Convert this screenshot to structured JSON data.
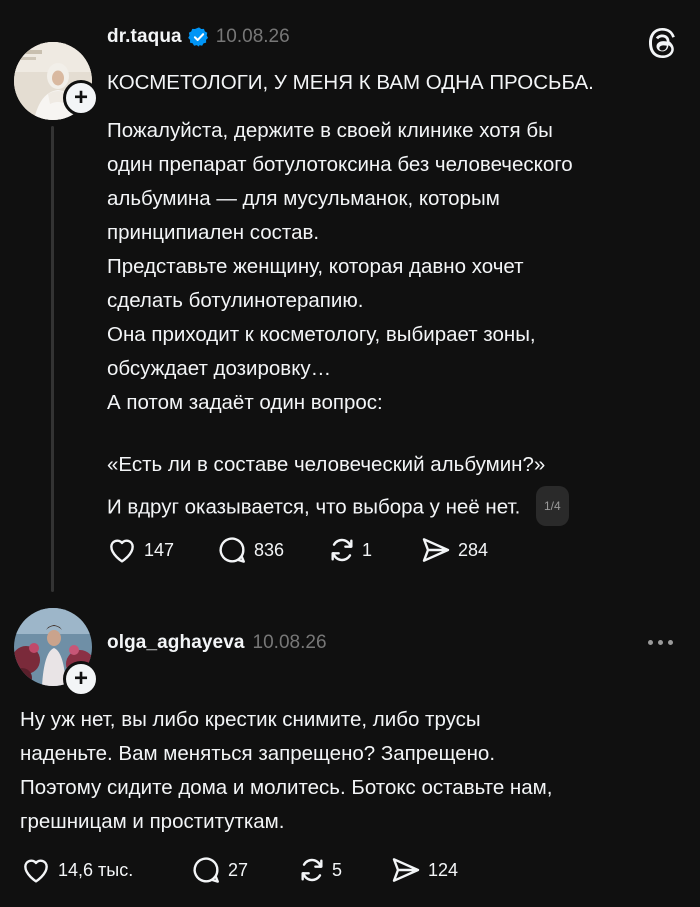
{
  "colors": {
    "background": "#101010",
    "text": "#f3f5f7",
    "muted": "#777777",
    "verified": "#0095f6"
  },
  "post": {
    "username": "dr.taqua",
    "date": "10.08.26",
    "verified_icon": "verified-badge-icon",
    "app_logo_icon": "threads-logo-icon",
    "headline": "КОСМЕТОЛОГИ, У МЕНЯ К ВАМ ОДНА ПРОСЬБА.",
    "body_lines": [
      "Пожалуйста, держите в своей клинике хотя бы",
      "один препарат ботулотоксина без человеческого",
      "альбумина — для мусульманок, которым",
      "принципиален состав.",
      "Представьте женщину, которая давно хочет",
      "сделать ботулинотерапию.",
      "Она приходит к косметологу, выбирает зоны,",
      "обсуждает дозировку…",
      "А потом задаёт один вопрос:"
    ],
    "quote_line": "«Есть ли в составе человеческий альбумин?»",
    "last_line": "И вдруг оказывается, что выбора у неё нет.",
    "pager": "1/4",
    "likes": "147",
    "replies": "836",
    "reposts": "1",
    "shares": "284"
  },
  "reply": {
    "username": "olga_aghayeva",
    "date": "10.08.26",
    "more_icon": "more-options-icon",
    "body_lines": [
      "Ну уж нет, вы либо крестик снимите, либо трусы",
      "наденьте. Вам меняться запрещено? Запрещено.",
      "Поэтому сидите дома и молитесь. Ботокс оставьте нам,",
      "грешницам и проституткам."
    ],
    "likes": "14,6 тыс.",
    "replies": "27",
    "reposts": "5",
    "shares": "124"
  }
}
